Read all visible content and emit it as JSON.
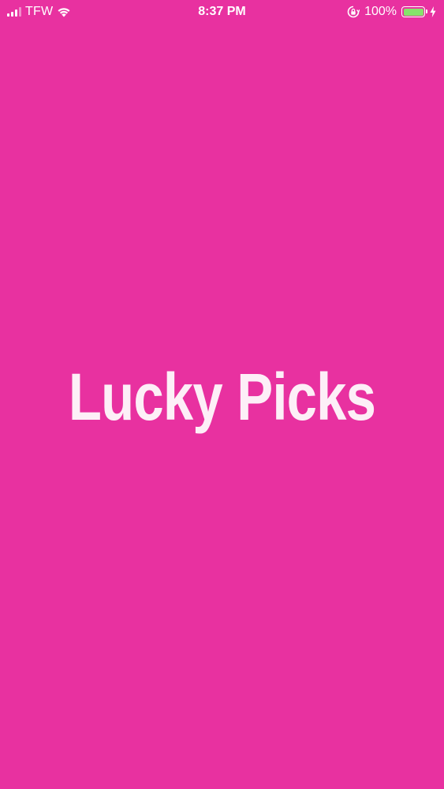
{
  "status_bar": {
    "carrier": "TFW",
    "time": "8:37 PM",
    "battery_percent": "100%",
    "battery_level": 1.0,
    "icons": [
      "signal-icon",
      "wifi-icon",
      "orientation-lock-icon",
      "battery-icon",
      "charging-bolt-icon"
    ]
  },
  "splash": {
    "title": "Lucky Picks"
  },
  "colors": {
    "background": "#E831A0",
    "title_text": "#FDEFF7",
    "battery_fill": "#86E36B"
  }
}
